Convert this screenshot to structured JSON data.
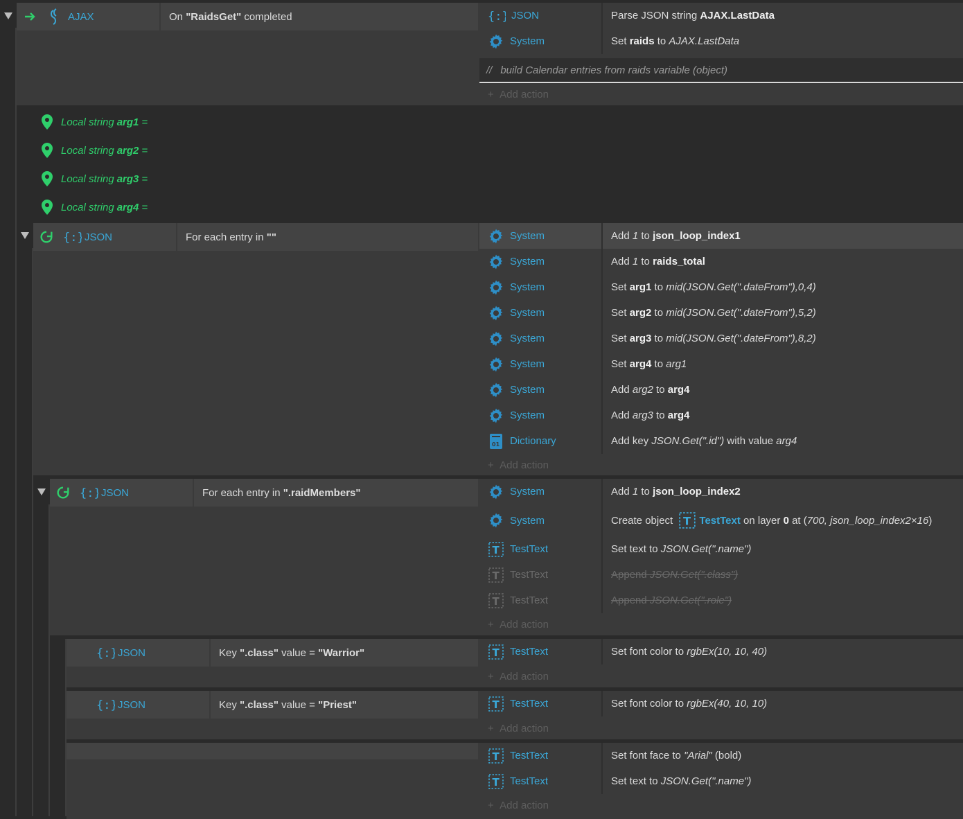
{
  "event_ajax": {
    "object": "AJAX",
    "condition_prefix": "On ",
    "condition_tag": "\"RaidsGet\"",
    "condition_suffix": " completed",
    "actions": [
      {
        "object": "JSON",
        "verb": "Parse JSON string ",
        "arg": "AJAX.LastData"
      },
      {
        "object": "System",
        "verb": "Set ",
        "var": "raids",
        "mid": " to ",
        "val": "AJAX.LastData"
      }
    ],
    "comment_slashes": "//",
    "comment": "build Calendar entries from raids variable (object)",
    "add_action": "Add action"
  },
  "locals": [
    {
      "kind": "Local string",
      "name": "arg1",
      "eq": "="
    },
    {
      "kind": "Local string",
      "name": "arg2",
      "eq": "="
    },
    {
      "kind": "Local string",
      "name": "arg3",
      "eq": "="
    },
    {
      "kind": "Local string",
      "name": "arg4",
      "eq": "="
    }
  ],
  "loop1": {
    "object": "JSON",
    "cond_prefix": "For each entry in ",
    "cond_tag": "\"\"",
    "actions": [
      {
        "object": "System",
        "a": "Add ",
        "b": "1",
        "c": " to ",
        "d": "json_loop_index1"
      },
      {
        "object": "System",
        "a": "Add ",
        "b": "1",
        "c": " to ",
        "d": "raids_total"
      },
      {
        "object": "System",
        "a": "Set ",
        "b": "arg1",
        "c": " to ",
        "d": "mid(JSON.Get(\".dateFrom\"),0,4)"
      },
      {
        "object": "System",
        "a": "Set ",
        "b": "arg2",
        "c": " to ",
        "d": "mid(JSON.Get(\".dateFrom\"),5,2)"
      },
      {
        "object": "System",
        "a": "Set ",
        "b": "arg3",
        "c": " to ",
        "d": "mid(JSON.Get(\".dateFrom\"),8,2)"
      },
      {
        "object": "System",
        "a": "Set ",
        "b": "arg4",
        "c": " to ",
        "d": "arg1"
      },
      {
        "object": "System",
        "a": "Add ",
        "b": "arg2",
        "c": " to ",
        "d": "arg4"
      },
      {
        "object": "System",
        "a": "Add ",
        "b": "arg3",
        "c": " to ",
        "d": "arg4"
      },
      {
        "object": "Dictionary",
        "a": "Add key ",
        "b": "JSON.Get(\".id\")",
        "c": " with value ",
        "d": "arg4"
      }
    ],
    "add_action": "Add action"
  },
  "loop2": {
    "object": "JSON",
    "cond_prefix": "For each entry in ",
    "cond_tag": "\".raidMembers\"",
    "actions": [
      {
        "object": "System",
        "a": "Add ",
        "b": "1",
        "c": " to ",
        "d": "json_loop_index2"
      },
      {
        "object": "System",
        "a": "Create object ",
        "b": "TestText",
        "c": " on layer ",
        "d": "0",
        "e": " at (",
        "f": "700, json_loop_index2×16",
        "g": ")"
      },
      {
        "object": "TestText",
        "a": "Set text to ",
        "b": "JSON.Get(\".name\")"
      },
      {
        "object": "TestText",
        "a": "Append ",
        "b": "JSON.Get(\".class\")"
      },
      {
        "object": "TestText",
        "a": "Append ",
        "b": "JSON.Get(\".role\")"
      }
    ],
    "add_action": "Add action"
  },
  "sub1": {
    "object": "JSON",
    "cond_a": "Key ",
    "cond_b": "\".class\"",
    "cond_c": " value = ",
    "cond_d": "\"Warrior\"",
    "action": {
      "object": "TestText",
      "a": "Set font color to ",
      "b": "rgbEx(10, 10, 40)"
    },
    "add_action": "Add action"
  },
  "sub2": {
    "object": "JSON",
    "cond_a": "Key ",
    "cond_b": "\".class\"",
    "cond_c": " value = ",
    "cond_d": "\"Priest\"",
    "action": {
      "object": "TestText",
      "a": "Set font color to ",
      "b": "rgbEx(40, 10, 10)"
    },
    "add_action": "Add action"
  },
  "sub3": {
    "actions": [
      {
        "object": "TestText",
        "a": "Set font face to ",
        "b": "\"Arial\"",
        "c": " (bold)"
      },
      {
        "object": "TestText",
        "a": "Set text to ",
        "b": "JSON.Get(\".name\")"
      }
    ],
    "add_action": "Add action"
  },
  "colors": {
    "accent": "#3aa8d8",
    "local": "#2fcf6b",
    "system": "#3aa8d8"
  }
}
